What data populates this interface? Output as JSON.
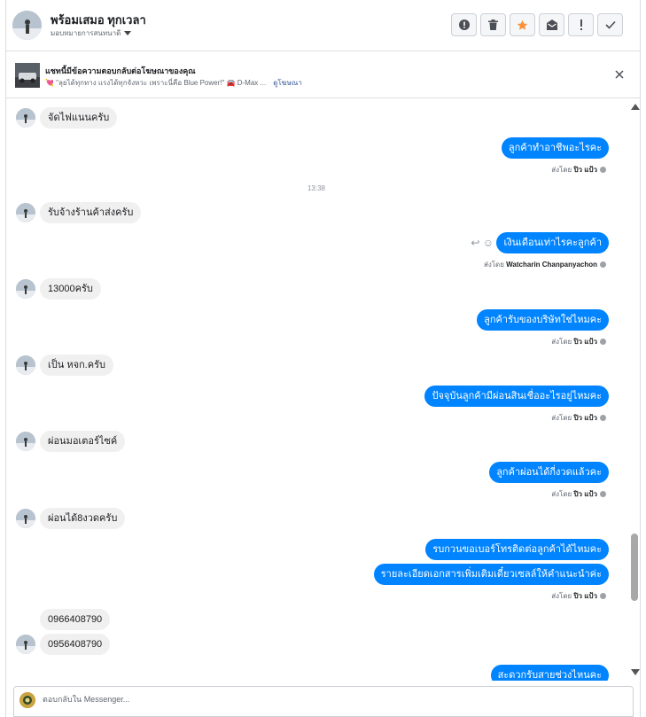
{
  "header": {
    "name": "พร้อมเสมอ ทุกเวลา",
    "subtitle": "มอบหมายการสนทนาดี",
    "buttons": [
      {
        "name": "spam-button",
        "icon": "exclamation-circle-icon"
      },
      {
        "name": "delete-button",
        "icon": "trash-icon"
      },
      {
        "name": "star-button",
        "icon": "star-icon",
        "color": "#f7923b"
      },
      {
        "name": "mark-unread-button",
        "icon": "envelope-open-icon"
      },
      {
        "name": "follow-up-button",
        "icon": "exclamation-icon"
      },
      {
        "name": "mark-done-button",
        "icon": "check-icon"
      }
    ]
  },
  "ad": {
    "title": "แชทนี้มีข้อความตอบกลับต่อโฆษณาของคุณ",
    "description": "💘 \"ลุยได้ทุกทาง แรงได้ทุกจังหวะ เพราะนี่คือ Blue Power!\" 🚘 D-Max ...",
    "link": "ดูโฆษณา"
  },
  "thread": {
    "messages": [
      {
        "dir": "in",
        "text": "จัดไฟแนนครับ"
      },
      {
        "dir": "out",
        "text": "ลูกค้าทำอาชีพอะไรคะ",
        "sent_prefix": "ส่งโดย",
        "sender": "ปิว แป้ว"
      },
      {
        "dir": "time",
        "text": "13:38"
      },
      {
        "dir": "in",
        "text": "รับจ้างร้านค้าส่งครับ"
      },
      {
        "dir": "out",
        "text": "เงินเดือนเท่าไรคะลูกค้า",
        "sent_prefix": "ส่งโดย",
        "sender": "Watcharin Chanpanyachon"
      },
      {
        "dir": "in",
        "text": "13000ครับ"
      },
      {
        "dir": "out",
        "text": "ลูกค้ารับของบริษัทใช่ไหมคะ",
        "sent_prefix": "ส่งโดย",
        "sender": "ปิว แป้ว"
      },
      {
        "dir": "in",
        "text": "เป็น หจก.ครับ"
      },
      {
        "dir": "out",
        "text": "ปัจจุบันลูกค้ามีผ่อนสินเชื่ออะไรอยู่ไหมคะ",
        "sent_prefix": "ส่งโดย",
        "sender": "ปิว แป้ว"
      },
      {
        "dir": "in",
        "text": "ผ่อนมอเตอร์ไซค์"
      },
      {
        "dir": "out",
        "text": "ลูกค้าผ่อนได้กี่งวดแล้วคะ",
        "sent_prefix": "ส่งโดย",
        "sender": "ปิว แป้ว"
      },
      {
        "dir": "in",
        "text": "ผ่อนได้8งวดครับ"
      },
      {
        "dir": "out",
        "text": "รบกวนขอเบอร์โทรติดต่อลูกค้าได้ไหมคะ"
      },
      {
        "dir": "out",
        "text": "รายละเอียดเอกสารเพิ่มเติมเดี๋ยวเซลล์ให้คำแนะนำค่ะ",
        "sent_prefix": "ส่งโดย",
        "sender": "ปิว แป้ว"
      },
      {
        "dir": "in",
        "text": "0966408790"
      },
      {
        "dir": "in",
        "text": "0956408790"
      },
      {
        "dir": "out",
        "text": "สะดวกรับสายช่วงไหนคะ"
      }
    ]
  },
  "composer": {
    "placeholder": "ตอบกลับใน Messenger..."
  },
  "colors": {
    "outgoing_bubble": "#0084ff",
    "incoming_bubble": "#f1f0f0",
    "star": "#f7923b"
  }
}
